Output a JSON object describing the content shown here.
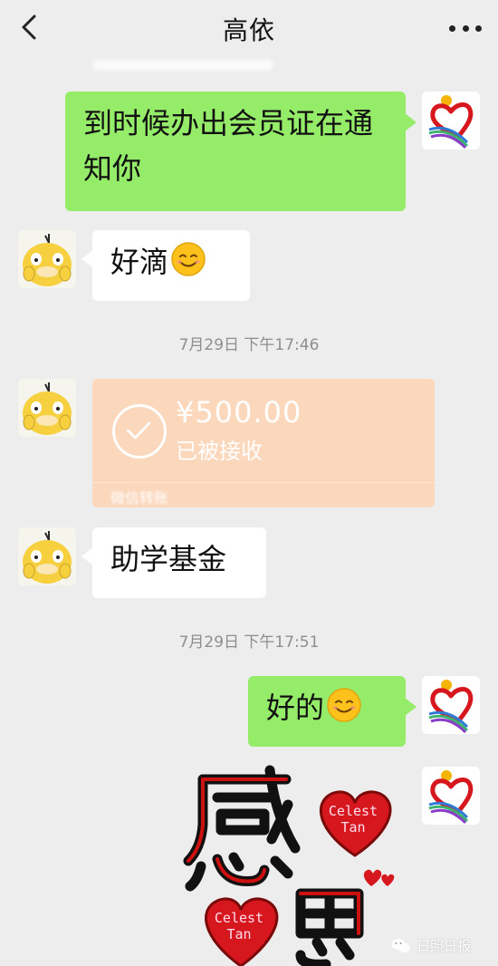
{
  "header": {
    "title": "高依",
    "back_icon": "chevron-left-icon",
    "more_icon": "more-dots-icon"
  },
  "messages": [
    {
      "sender": "me",
      "text": "到时候办出会员证在通知你"
    },
    {
      "sender": "other",
      "text": "好滴",
      "emoji": "smile-emoji"
    },
    {
      "sender": "other",
      "type": "transfer"
    },
    {
      "sender": "other",
      "text": "助学基金"
    },
    {
      "sender": "me",
      "text": "好的",
      "emoji": "smile-emoji"
    },
    {
      "sender": "me",
      "type": "sticker"
    }
  ],
  "timestamps": [
    "7月29日 下午17:46",
    "7月29日 下午17:51"
  ],
  "transfer": {
    "amount": "¥500.00",
    "status": "已被接收",
    "footer": "微信转账"
  },
  "sticker": {
    "heart_text_line1": "Celest",
    "heart_text_line2": "Tan"
  },
  "watermark": {
    "text": "日照日报",
    "icon": "wechat-icon"
  },
  "colors": {
    "background": "#ededed",
    "green_bubble": "#95ec69",
    "white_bubble": "#ffffff",
    "transfer_bg": "#fbd7bc",
    "heart": "#d6171d"
  }
}
